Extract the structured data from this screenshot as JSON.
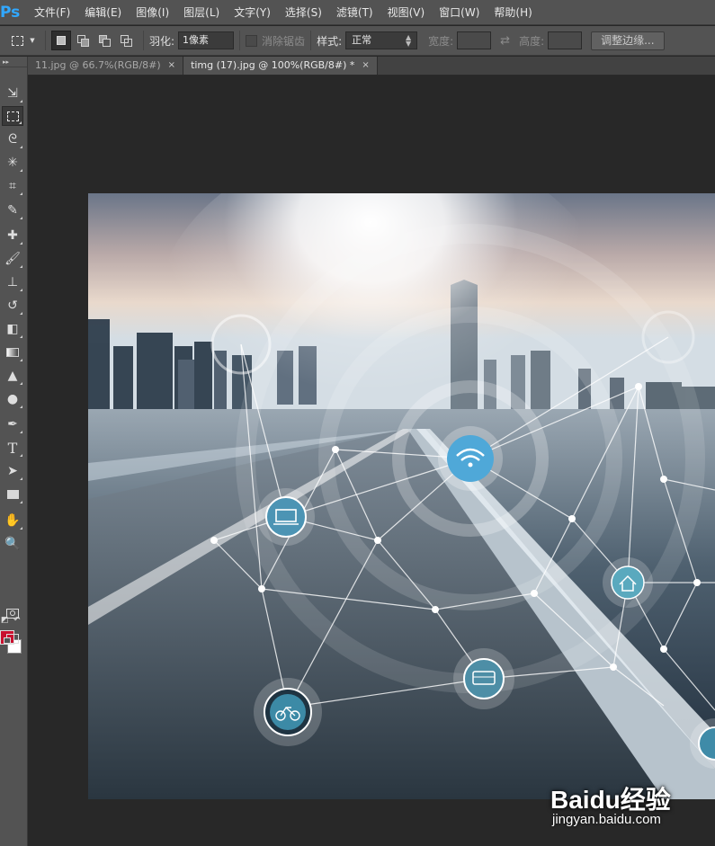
{
  "app": {
    "logo": "Ps"
  },
  "menu": [
    "文件(F)",
    "编辑(E)",
    "图像(I)",
    "图层(L)",
    "文字(Y)",
    "选择(S)",
    "滤镜(T)",
    "视图(V)",
    "窗口(W)",
    "帮助(H)"
  ],
  "options": {
    "feather_label": "羽化:",
    "feather_value": "1像素",
    "antialias_label": "消除锯齿",
    "style_label": "样式:",
    "style_value": "正常",
    "width_label": "宽度:",
    "height_label": "高度:",
    "refine_edge_label": "调整边缘..."
  },
  "tabs": [
    {
      "label": "11.jpg @ 66.7%(RGB/8#)",
      "close": "×",
      "active": false
    },
    {
      "label": "timg (17).jpg @ 100%(RGB/8#) *",
      "close": "×",
      "active": true
    }
  ],
  "tools": {
    "active_tool": "rectangular-marquee",
    "foreground_color": "#c8102e",
    "background_color": "#ffffff",
    "type_tool_glyph": "T"
  },
  "colors": {
    "accent_blue": "#31a8ff",
    "panel_bg": "#535353",
    "workspace_bg": "#282828",
    "network_node": "#4fb0d8"
  },
  "watermark": {
    "brand": "Baidu经验",
    "url": "jingyan.baidu.com"
  }
}
